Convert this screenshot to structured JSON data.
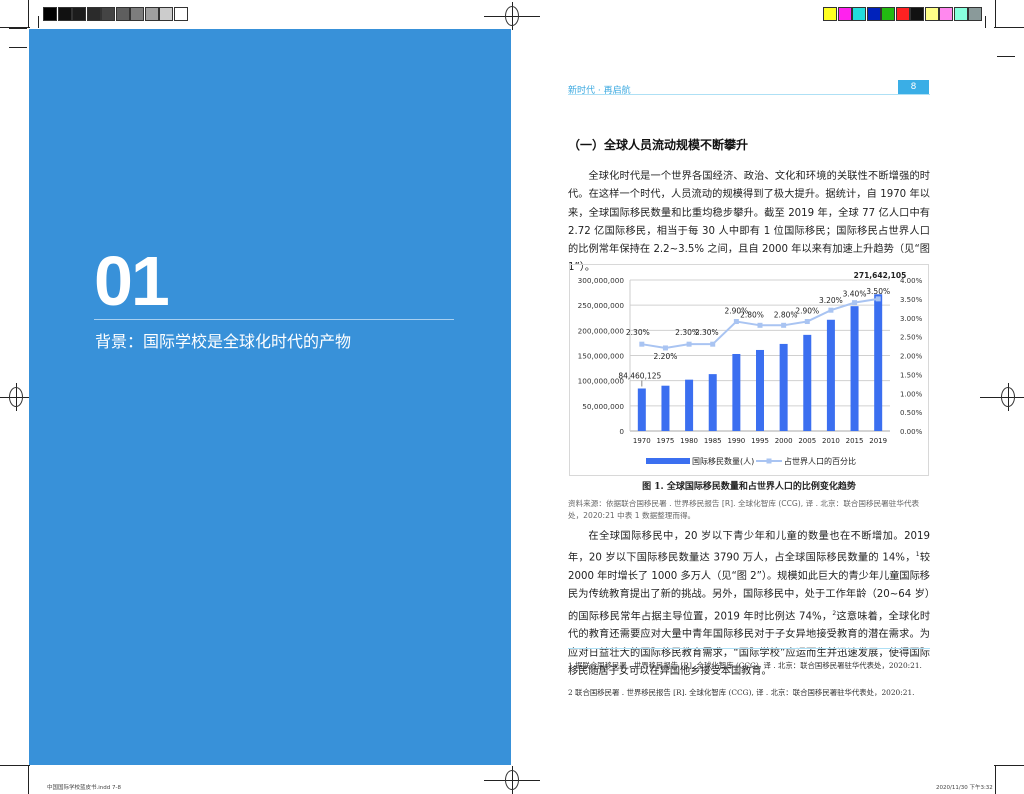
{
  "colors": {
    "blue_panel": "#3891d9",
    "accent": "#3aaee6",
    "bar": "#3b6ff0",
    "line": "#a9c4f2"
  },
  "calibration": {
    "gray": [
      "#000000",
      "#111111",
      "#1c1c1c",
      "#2b2b2b",
      "#444444",
      "#5e5e5e",
      "#7d7d7d",
      "#a0a0a0",
      "#cccccc",
      "#ffffff"
    ],
    "color": [
      "#ffff22",
      "#ff22ee",
      "#22dddd",
      "#0022bb",
      "#22bb11",
      "#ff2222",
      "#111111",
      "#ffff88",
      "#ff88ee",
      "#88ffdd",
      "#8a9a9a"
    ]
  },
  "left_page": {
    "chapter_number": "01",
    "chapter_title": "背景：国际学校是全球化时代的产物"
  },
  "right_page": {
    "running_head": "新时代 · 再启航",
    "page_number": "8",
    "section_title": "（一）全球人员流动规模不断攀升",
    "para1": "全球化时代是一个世界各国经济、政治、文化和环境的关联性不断增强的时代。在这样一个时代，人员流动的规模得到了极大提升。据统计，自 1970 年以来，全球国际移民数量和比重均稳步攀升。截至 2019 年，全球 77 亿人口中有 2.72 亿国际移民，相当于每 30 人中即有 1 位国际移民；国际移民占世界人口的比例常年保持在 2.2~3.5% 之间，且自 2000 年以来有加速上升趋势（见“图 1”）。",
    "figure_caption": "图 1. 全球国际移民数量和占世界人口的比例变化趋势",
    "source": "资料来源：依据联合国移民署 . 世界移民报告 [R]. 全球化智库 (CCG), 译 . 北京：联合国移民署驻华代表处，2020:21 中表 1 数据整理而得。",
    "para2a": "在全球国际移民中，20 岁以下青少年和儿童的数量也在不断增加。2019 年，20 岁以下国际移民数量达 3790 万人，占全球国际移民数量的 14%，",
    "fnref1": "1",
    "para2b": "较 2000 年时增长了 1000 多万人（见“图 2”）。规模如此巨大的青少年儿童国际移民为传统教育提出了新的挑战。另外，国际移民中，处于工作年龄（20~64 岁）的国际移民常年占据主导位置，2019 年时比例达 74%，",
    "fnref2": "2",
    "para2c": "这意味着，全球化时代的教育还需要应对大量中青年国际移民对于子女异地接受教育的潜在需求。为应对日益壮大的国际移民教育需求，“国际学校”应运而生并迅速发展，使得国际移民随居子女可以在异国他乡接受本国教育。",
    "footnote1": "1 据联合国移民署 . 世界移民报告 [R]. 全球化智库 (CCG), 译 . 北京：联合国移民署驻华代表处，2020:21.",
    "footnote2": "2 联合国移民署 . 世界移民报告 [R]. 全球化智库 (CCG), 译 . 北京：联合国移民署驻华代表处，2020:21."
  },
  "slug": {
    "left": "中国国际学校蓝皮书.indd 7-8",
    "right": "2020/11/30 下午3:32"
  },
  "chart_data": {
    "type": "bar+line",
    "title": "图 1. 全球国际移民数量和占世界人口的比例变化趋势",
    "categories": [
      "1970",
      "1975",
      "1980",
      "1985",
      "1990",
      "1995",
      "2000",
      "2005",
      "2010",
      "2015",
      "2019"
    ],
    "series": [
      {
        "name": "国际移民数量(人)",
        "type": "bar",
        "axis": "left",
        "values": [
          84460125,
          90000000,
          102000000,
          113000000,
          153000000,
          161000000,
          173000000,
          191000000,
          221000000,
          248000000,
          271642105
        ]
      },
      {
        "name": "占世界人口的百分比",
        "type": "line",
        "axis": "right",
        "values": [
          2.3,
          2.2,
          2.3,
          2.3,
          2.9,
          2.8,
          2.8,
          2.9,
          3.2,
          3.4,
          3.5
        ],
        "labels": [
          "2.30%",
          "2.20%",
          "2.30%",
          "2.30%",
          "2.90%",
          "2.80%",
          "2.80%",
          "2.90%",
          "3.20%",
          "3.40%",
          "3.50%"
        ]
      }
    ],
    "bar_labels": {
      "first": "84,460,125",
      "last": "271,642,105"
    },
    "left_ticks": [
      "0",
      "50,000,000",
      "100,000,000",
      "150,000,000",
      "200,000,000",
      "250,000,000",
      "300,000,000"
    ],
    "right_ticks": [
      "0.00%",
      "0.50%",
      "1.00%",
      "1.50%",
      "2.00%",
      "2.50%",
      "3.00%",
      "3.50%",
      "4.00%"
    ],
    "ylim_left": [
      0,
      300000000
    ],
    "ylim_right": [
      0,
      4
    ],
    "grid": true,
    "legend": "bottom"
  }
}
